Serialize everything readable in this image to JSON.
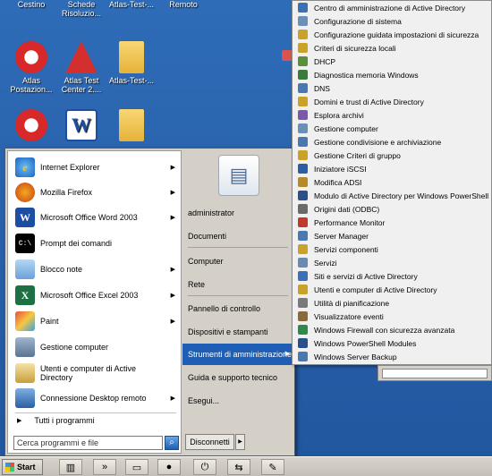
{
  "desktop": {
    "icons": [
      {
        "label": "Cestino"
      },
      {
        "label": "Schede Risoluzio..."
      },
      {
        "label": "Atlas-Test-..."
      },
      {
        "label": "Remoto"
      },
      {
        "label": "Atlas Postazion..."
      },
      {
        "label": "Atlas Test Center 2...."
      },
      {
        "label": "Atlas-Test-..."
      }
    ]
  },
  "start_menu": {
    "programs": [
      {
        "label": "Internet Explorer",
        "icon": "internet-explorer-icon",
        "has_submenu": true
      },
      {
        "label": "Mozilla Firefox",
        "icon": "firefox-icon",
        "has_submenu": true
      },
      {
        "label": "Microsoft Office Word 2003",
        "icon": "word-icon",
        "has_submenu": true
      },
      {
        "label": "Prompt dei comandi",
        "icon": "command-prompt-icon",
        "has_submenu": false
      },
      {
        "label": "Blocco note",
        "icon": "notepad-icon",
        "has_submenu": true
      },
      {
        "label": "Microsoft Office Excel 2003",
        "icon": "excel-icon",
        "has_submenu": true
      },
      {
        "label": "Paint",
        "icon": "paint-icon",
        "has_submenu": true
      },
      {
        "label": "Gestione computer",
        "icon": "server-manager-icon",
        "has_submenu": false
      },
      {
        "label": "Utenti e computer di Active Directory",
        "icon": "ad-users-icon",
        "has_submenu": false
      },
      {
        "label": "Connessione Desktop remoto",
        "icon": "remote-desktop-icon",
        "has_submenu": true
      }
    ],
    "all_programs_label": "Tutti i programmi",
    "search_placeholder": "Cerca programmi e file",
    "right_items": [
      {
        "label": "administrator"
      },
      {
        "label": "Documenti"
      },
      {
        "label": "Computer"
      },
      {
        "label": "Rete"
      },
      {
        "label": "Pannello di controllo"
      },
      {
        "label": "Dispositivi e stampanti"
      },
      {
        "label": "Strumenti di amministrazione"
      },
      {
        "label": "Guida e supporto tecnico"
      },
      {
        "label": "Esegui..."
      }
    ],
    "shutdown_label": "Disconnetti"
  },
  "admin_tools_submenu": {
    "items": [
      {
        "label": "Centro di amministrazione di Active Directory",
        "color": "#3b6fb6"
      },
      {
        "label": "Configurazione di sistema",
        "color": "#6c8fb8"
      },
      {
        "label": "Configurazione guidata impostazioni di sicurezza",
        "color": "#c9a227"
      },
      {
        "label": "Criteri di sicurezza locali",
        "color": "#c9a227"
      },
      {
        "label": "DHCP",
        "color": "#5a8f3c"
      },
      {
        "label": "Diagnostica memoria Windows",
        "color": "#3c7a3c"
      },
      {
        "label": "DNS",
        "color": "#4a78b0"
      },
      {
        "label": "Domini e trust di Active Directory",
        "color": "#c9a227"
      },
      {
        "label": "Esplora archivi",
        "color": "#7a5aa8"
      },
      {
        "label": "Gestione computer",
        "color": "#6c8fb8"
      },
      {
        "label": "Gestione condivisione e archiviazione",
        "color": "#4a78b0"
      },
      {
        "label": "Gestione Criteri di gruppo",
        "color": "#c9a227"
      },
      {
        "label": "Iniziatore iSCSI",
        "color": "#2a5fa4"
      },
      {
        "label": "Modifica ADSI",
        "color": "#b58a2a"
      },
      {
        "label": "Modulo di Active Directory per Windows PowerShell",
        "color": "#2a4f8a"
      },
      {
        "label": "Origini dati (ODBC)",
        "color": "#6a6a6a"
      },
      {
        "label": "Performance Monitor",
        "color": "#c0392b"
      },
      {
        "label": "Server Manager",
        "color": "#4a78b0"
      },
      {
        "label": "Servizi componenti",
        "color": "#c9a227"
      },
      {
        "label": "Servizi",
        "color": "#6a8ab0"
      },
      {
        "label": "Siti e servizi di Active Directory",
        "color": "#3b6fb6"
      },
      {
        "label": "Utenti e computer di Active Directory",
        "color": "#c9a227"
      },
      {
        "label": "Utilità di pianificazione",
        "color": "#7a7a7a"
      },
      {
        "label": "Visualizzatore eventi",
        "color": "#8a6a3a"
      },
      {
        "label": "Windows Firewall con sicurezza avanzata",
        "color": "#2e8a4a"
      },
      {
        "label": "Windows PowerShell Modules",
        "color": "#2a4f8a"
      },
      {
        "label": "Windows Server Backup",
        "color": "#4a78b0"
      }
    ]
  },
  "taskbar": {
    "start_label": "Start"
  }
}
